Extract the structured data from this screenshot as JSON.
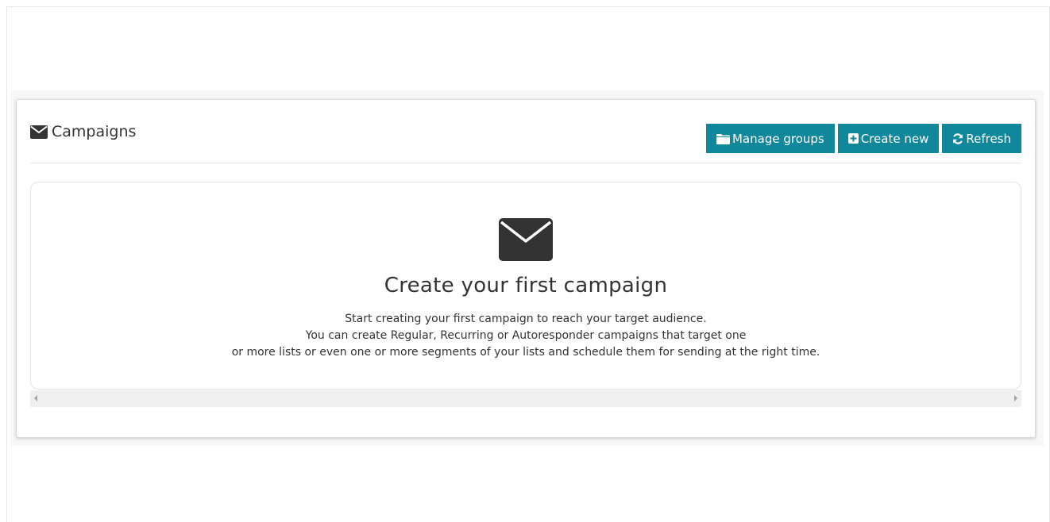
{
  "panel": {
    "title": "Campaigns",
    "title_icon": "envelope-icon"
  },
  "toolbar": {
    "manage_groups": {
      "label": "Manage groups",
      "icon": "folder-icon"
    },
    "create_new": {
      "label": "Create new",
      "icon": "plus-square-icon"
    },
    "refresh": {
      "label": "Refresh",
      "icon": "refresh-icon"
    }
  },
  "empty_state": {
    "icon": "envelope-icon",
    "title": "Create your first campaign",
    "lines": [
      "Start creating your first campaign to reach your target audience.",
      "You can create Regular, Recurring or Autoresponder campaigns that target one",
      "or more lists or even one or more segments of your lists and schedule them for sending at the right time."
    ]
  },
  "colors": {
    "button_bg": "#11879c",
    "text": "#333333",
    "icon": "#333333"
  }
}
